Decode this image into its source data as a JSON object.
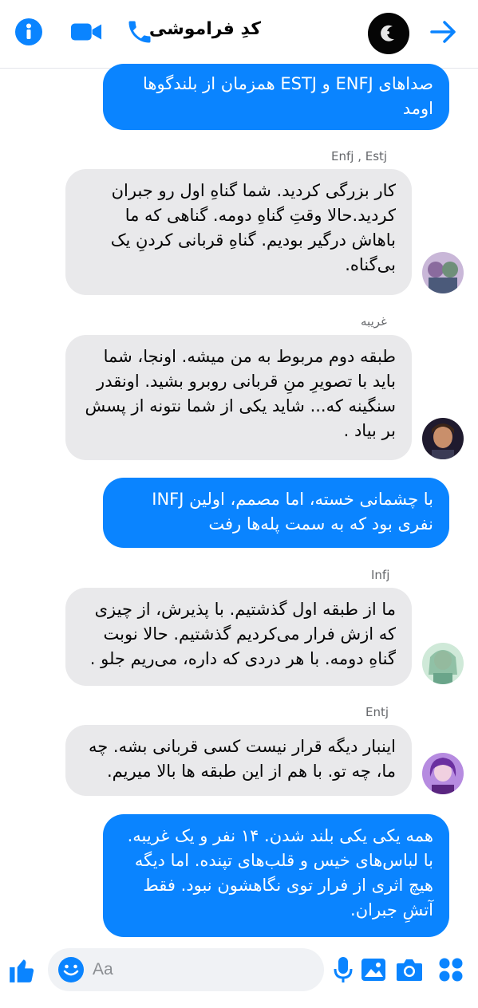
{
  "header": {
    "title": "کدِ فراموشی",
    "icons": [
      "back-arrow-icon",
      "info-icon",
      "video-camera-icon",
      "phone-icon"
    ]
  },
  "messages": [
    {
      "id": "m1",
      "direction": "outgoing",
      "text": "صداهای ENFJ و ESTJ همزمان از بلندگوها\nاومد"
    },
    {
      "id": "m2",
      "direction": "incoming",
      "sender": "Enfj , Estj",
      "text": "کار بزرگی کردید. شما گناهِ اول رو جبران\nکردید.حالا وقتِ گناهِ دومه. گناهی که ما\nباهاش درگیر بودیم. گناهِ قربانی کردنِ یک\nبی‌گناه."
    },
    {
      "id": "m3",
      "direction": "incoming",
      "sender": "غریبه",
      "text": "طبقه دوم مربوط به من میشه. اونجا، شما\nباید با تصویرِ منِ قربانی روبرو بشید. اونقدر\nسنگینه که... شاید یکی از شما نتونه از پسش\nبر بیاد ."
    },
    {
      "id": "m4",
      "direction": "outgoing",
      "text": "با چشمانی خسته، اما مصمم، اولین INFJ\nنفری بود  که به سمت پله‌ها رفت"
    },
    {
      "id": "m5",
      "direction": "incoming",
      "sender": "Infj",
      "text": "ما از طبقه اول گذشتیم. با پذیرش، از چیزی\nکه ازش فرار می‌کردیم گذشتیم. حالا نوبت\nگناهِ دومه. با هر دردی که داره، می‌ریم جلو ."
    },
    {
      "id": "m6",
      "direction": "incoming",
      "sender": "Entj",
      "text": "اینبار دیگه قرار نیست کسی قربانی بشه. چه\nما، چه تو. با هم از این طبقه ها بالا میریم."
    },
    {
      "id": "m7",
      "direction": "outgoing",
      "text": "همه یکی یکی بلند شدن. ۱۴ نفر و یک غریبه.\nبا لباس‌های خیس و قلب‌های تپنده. اما دیگه\nهیچ اثری از فرار توی نگاهشون نبود. فقط\nآتشِ جبران."
    }
  ],
  "composer": {
    "placeholder": "Aa",
    "value": "",
    "icons": [
      "apps-icon",
      "camera-icon",
      "gallery-icon",
      "microphone-icon",
      "emoji-icon",
      "thumbs-up-icon"
    ]
  },
  "colors": {
    "accent": "#0a84ff",
    "incoming_bubble": "#e9e9eb",
    "outgoing_bubble": "#0a84ff",
    "icon_blue": "#0a84ff"
  }
}
